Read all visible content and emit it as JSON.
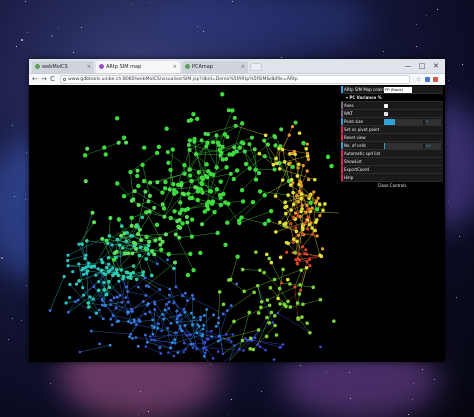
{
  "browser": {
    "tabs": [
      {
        "label": "webMolCS",
        "icon_color": "#5aa05a"
      },
      {
        "label": "ARtp SIM map",
        "icon_color": "#9b4fc9"
      },
      {
        "label": "PCAmap",
        "icon_color": "#5aa05a"
      }
    ],
    "address": "www.gdbtools.unibe.ch:8080/webMolCS/visualiserSIM.jsp?dbid=Demo%5fARtp%5fSIM&dbfile=ARtp",
    "window_controls": {
      "minimize": "—",
      "maximize": "□",
      "close": "✕"
    },
    "nav": {
      "back": "←",
      "forward": "→",
      "reload": "C"
    }
  },
  "gui": {
    "map_colors_label": "ARtp SIM Map colors",
    "map_colors_value": "FP (Rank)",
    "pc_variance_label": "▾ PC Variance %",
    "rows": {
      "axes_label": "Axes",
      "wkt_label": "WKT",
      "point_size_label": "Point size",
      "point_size_value": "5",
      "set_pivot_label": "Set as pivot point",
      "reset_view_label": "Reset view",
      "nb_cells_label": "No. of cells",
      "nb_cells_value": "54",
      "autospin_label": "Automatic spd list",
      "showlist_label": "ShowList",
      "exportcoord_label": "ExportCoord",
      "help_label": "Help"
    },
    "close_label": "Close Controls",
    "point_size_fraction": 0.28,
    "nb_cells_fraction": 0.02
  },
  "colors": {
    "accent": "#2fa1d6",
    "gui_bg": "#1a1a1a",
    "green": "#3dd43d",
    "cyan": "#2ec9c0",
    "blue": "#3b52d9",
    "yellow": "#e6e63a",
    "red": "#e23a2a"
  }
}
